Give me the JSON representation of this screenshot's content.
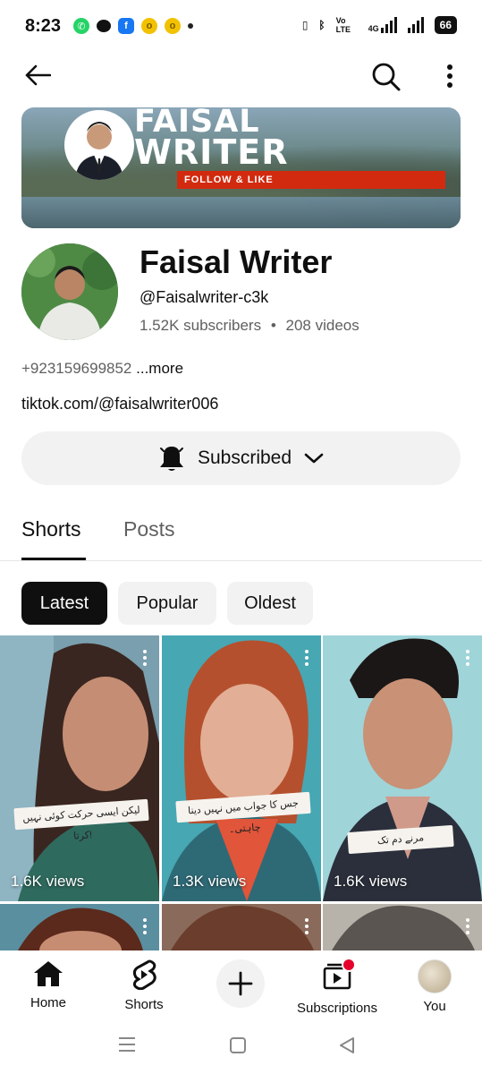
{
  "status_bar": {
    "time": "8:23",
    "network_type": "4G",
    "volte_label": "Vo LTE",
    "battery": "66",
    "notification_icons": [
      "whatsapp-icon",
      "chat-icon",
      "facebook-icon",
      "coin-icon",
      "coin-icon",
      "more-dot-icon"
    ]
  },
  "topbar": {
    "back_icon": "arrow-left-icon",
    "search_icon": "search-icon",
    "more_icon": "more-vertical-icon"
  },
  "banner": {
    "title_line1": "FAISAL",
    "title_line2": "WRITER",
    "cta": "FOLLOW & LIKE"
  },
  "channel": {
    "name": "Faisal Writer",
    "handle": "@Faisalwriter-c3k",
    "subscribers": "1.52K subscribers",
    "separator": "•",
    "videos": "208 videos",
    "description": "+923159699852",
    "more": "...more",
    "link": "tiktok.com/@faisalwriter006"
  },
  "subscribe_button": {
    "label": "Subscribed",
    "bell_icon": "bell-icon",
    "chevron_icon": "chevron-down-icon"
  },
  "tabs": [
    {
      "label": "Shorts",
      "active": true
    },
    {
      "label": "Posts",
      "active": false
    }
  ],
  "filters": [
    {
      "label": "Latest",
      "active": true
    },
    {
      "label": "Popular",
      "active": false
    },
    {
      "label": "Oldest",
      "active": false
    }
  ],
  "shorts": [
    {
      "views": "1.6K views",
      "caption": "لیکن ایسی حرکت کوئی نہیں کرتا!"
    },
    {
      "views": "1.3K views",
      "caption": "جس کا جواب میں نہیں دینا چاہتی۔"
    },
    {
      "views": "1.6K views",
      "caption": "مرنے دم تک"
    }
  ],
  "bottom_nav": [
    {
      "label": "Home",
      "icon": "home-icon",
      "active": true
    },
    {
      "label": "Shorts",
      "icon": "shorts-icon",
      "active": false
    },
    {
      "label": "",
      "icon": "plus-icon",
      "active": false
    },
    {
      "label": "Subscriptions",
      "icon": "subscriptions-icon",
      "active": false
    },
    {
      "label": "You",
      "icon": "profile-avatar",
      "active": false
    }
  ],
  "colors": {
    "text": "#0f0f0f",
    "secondary_text": "#606060",
    "chip_bg": "#f2f2f2",
    "banner_cta": "#d22a0f",
    "notification_dot": "#e5002b"
  }
}
